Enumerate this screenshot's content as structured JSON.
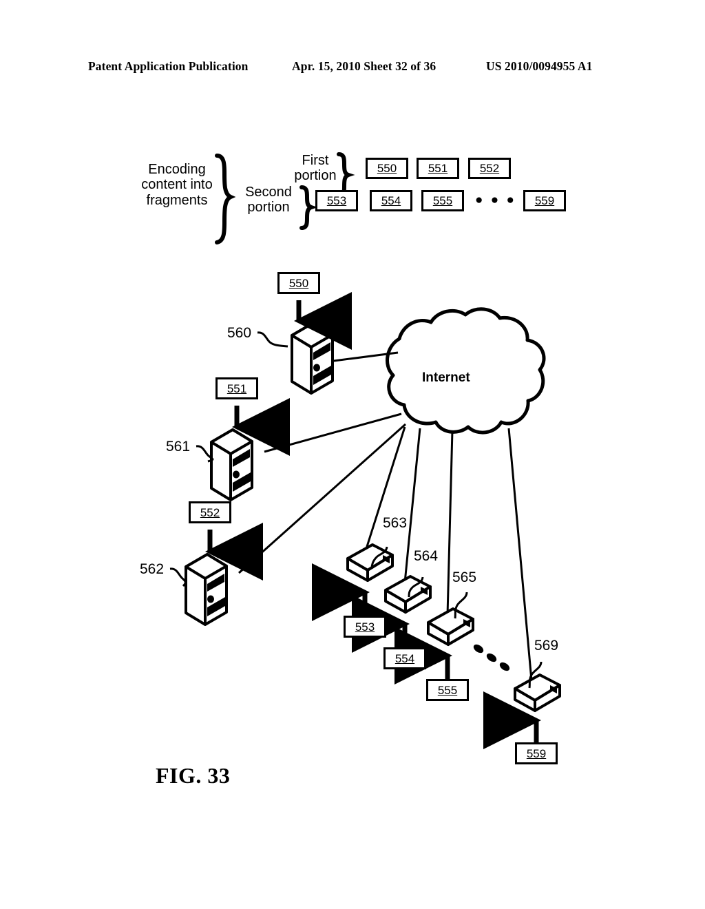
{
  "header": {
    "publication": "Patent Application Publication",
    "date_sheet": "Apr. 15, 2010  Sheet 32 of 36",
    "patent_number": "US 2010/0094955 A1"
  },
  "figure": {
    "caption": "FIG. 33"
  },
  "encoding_diagram": {
    "main_label": "Encoding\ncontent into\nfragments",
    "first_portion_label": "First\nportion",
    "second_portion_label": "Second\nportion",
    "first_portion_fragments": [
      "550",
      "551",
      "552"
    ],
    "second_portion_fragments": [
      "553",
      "554",
      "555"
    ],
    "second_portion_ellipsis": "● ● ●",
    "second_portion_last_fragment": "559"
  },
  "network_diagram": {
    "cloud_label": "Internet",
    "servers": [
      {
        "ref": "560",
        "fragment": "550"
      },
      {
        "ref": "561",
        "fragment": "551"
      },
      {
        "ref": "562",
        "fragment": "552"
      }
    ],
    "clients": [
      {
        "ref": "563",
        "fragment": "553"
      },
      {
        "ref": "564",
        "fragment": "554"
      },
      {
        "ref": "565",
        "fragment": "555"
      },
      {
        "ref": "569",
        "fragment": "559"
      }
    ],
    "ellipsis": "● ● ●"
  },
  "colors": {
    "ink": "#000000",
    "paper": "#ffffff"
  }
}
